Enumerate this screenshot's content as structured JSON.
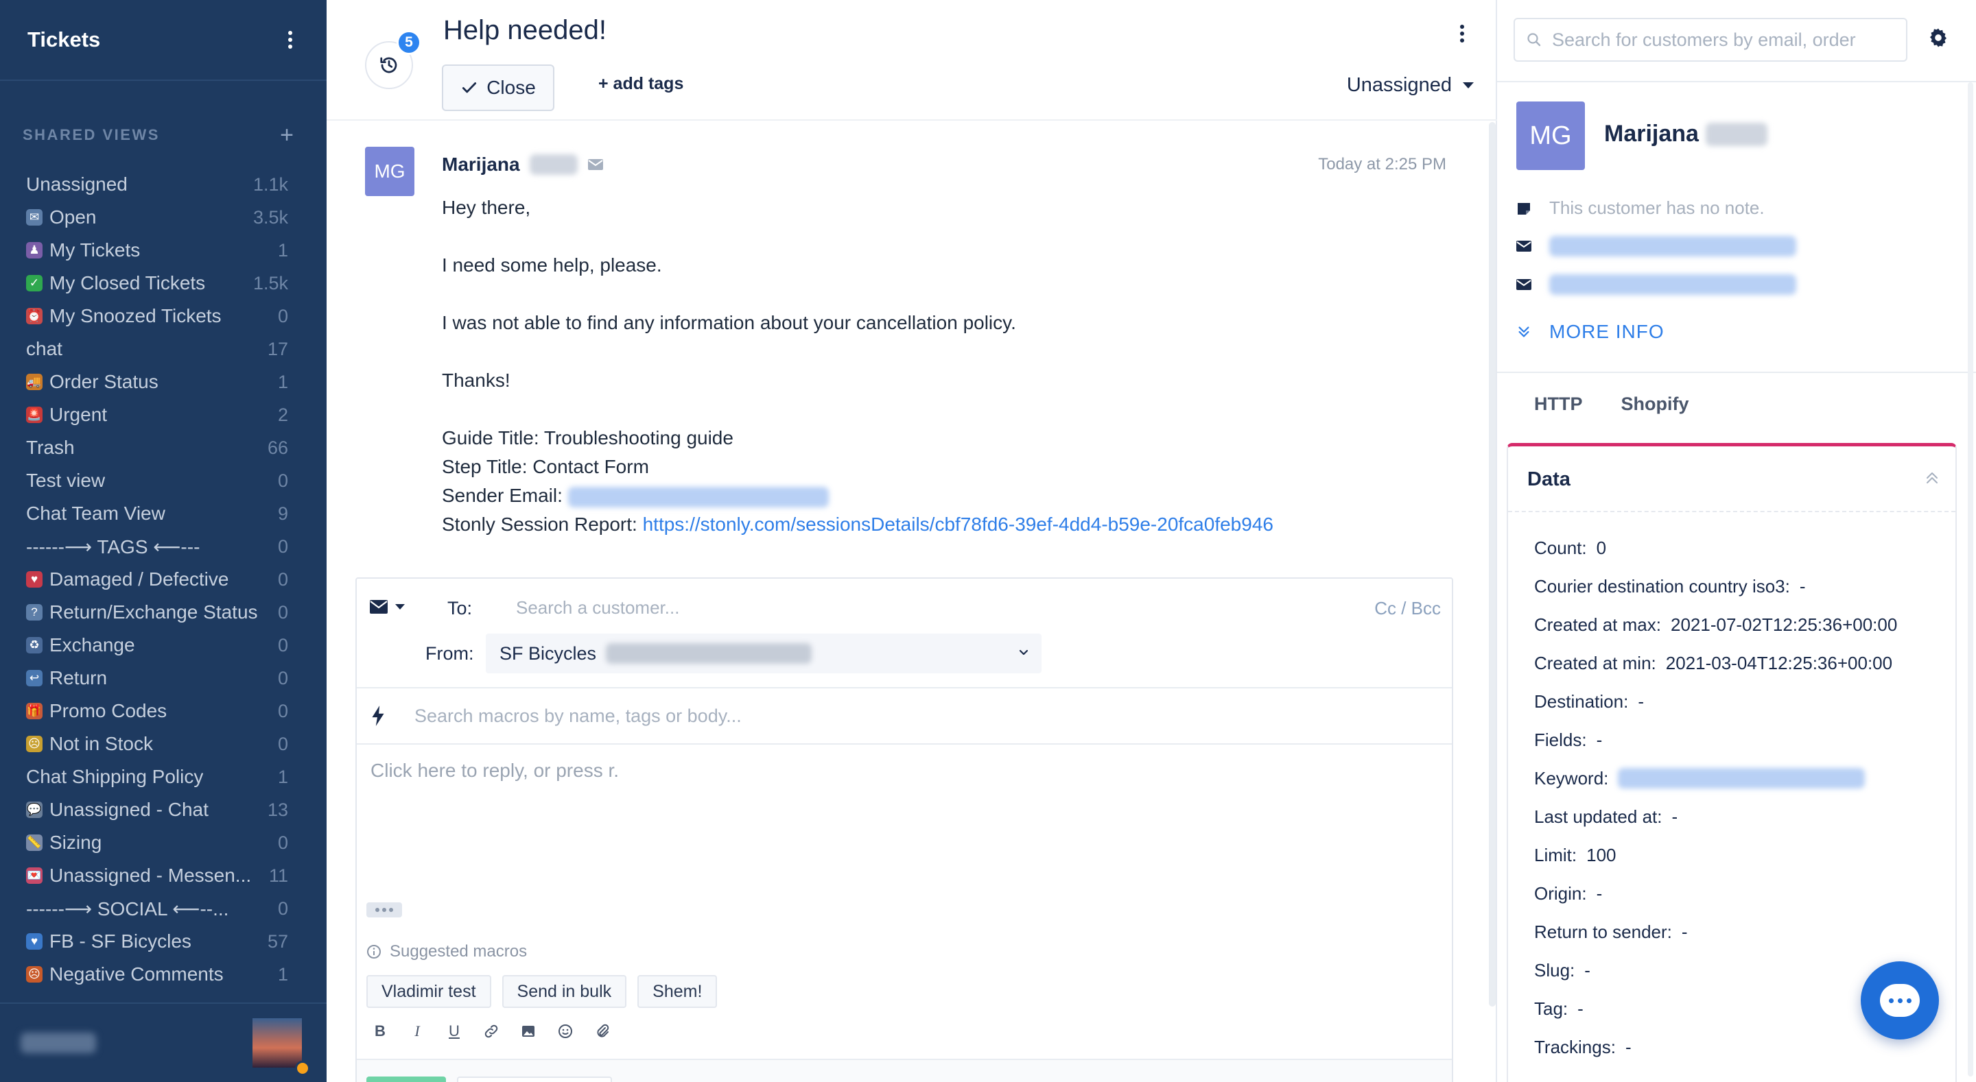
{
  "sidebar": {
    "title": "Tickets",
    "section_label": "SHARED VIEWS",
    "add_label": "+",
    "views": [
      {
        "label": "Unassigned",
        "count": "1.1k",
        "emoji": "",
        "color": ""
      },
      {
        "label": "Open",
        "count": "3.5k",
        "emoji": "✉",
        "color": "#5d7ea8"
      },
      {
        "label": "My Tickets",
        "count": "1",
        "emoji": "♟",
        "color": "#7b5ea8"
      },
      {
        "label": "My Closed Tickets",
        "count": "1.5k",
        "emoji": "✓",
        "color": "#2fa84f"
      },
      {
        "label": "My Snoozed Tickets",
        "count": "0",
        "emoji": "⏰",
        "color": "#c84a4a"
      },
      {
        "label": "chat",
        "count": "17",
        "emoji": "",
        "color": ""
      },
      {
        "label": "Order Status",
        "count": "1",
        "emoji": "🚚",
        "color": "#c87a2a"
      },
      {
        "label": "Urgent",
        "count": "2",
        "emoji": "🚨",
        "color": "#c83a3a"
      },
      {
        "label": "Trash",
        "count": "66",
        "emoji": "",
        "color": ""
      },
      {
        "label": "Test view",
        "count": "0",
        "emoji": "",
        "color": ""
      },
      {
        "label": "Chat Team View",
        "count": "9",
        "emoji": "",
        "color": ""
      },
      {
        "label": "------⟶ TAGS ⟵---",
        "count": "0",
        "emoji": "",
        "color": ""
      },
      {
        "label": "Damaged / Defective",
        "count": "0",
        "emoji": "♥",
        "color": "#c83a4a"
      },
      {
        "label": "Return/Exchange Status",
        "count": "0",
        "emoji": "?",
        "color": "#5d7ea8"
      },
      {
        "label": "Exchange",
        "count": "0",
        "emoji": "♻",
        "color": "#4a6a98"
      },
      {
        "label": "Return",
        "count": "0",
        "emoji": "↩",
        "color": "#4a78b0"
      },
      {
        "label": "Promo Codes",
        "count": "0",
        "emoji": "🎁",
        "color": "#c85a3a"
      },
      {
        "label": "Not in Stock",
        "count": "0",
        "emoji": "☹",
        "color": "#c8a030"
      },
      {
        "label": "Chat Shipping Policy",
        "count": "1",
        "emoji": "",
        "color": ""
      },
      {
        "label": "Unassigned - Chat",
        "count": "13",
        "emoji": "💬",
        "color": "#6a7e98"
      },
      {
        "label": "Sizing",
        "count": "0",
        "emoji": "📏",
        "color": "#7a8aa8"
      },
      {
        "label": "Unassigned - Messen...",
        "count": "11",
        "emoji": "💌",
        "color": "#c84a6a"
      },
      {
        "label": "------⟶ SOCIAL ⟵--...",
        "count": "0",
        "emoji": "",
        "color": ""
      },
      {
        "label": "FB - SF Bicycles",
        "count": "57",
        "emoji": "♥",
        "color": "#3a78c8"
      },
      {
        "label": "Negative Comments",
        "count": "1",
        "emoji": "☹",
        "color": "#c85a2a"
      }
    ]
  },
  "ticket": {
    "title": "Help needed!",
    "history_count": "5",
    "close_label": "Close",
    "add_tags_label": "add tags",
    "assignee": "Unassigned"
  },
  "message": {
    "avatar_initials": "MG",
    "sender_first_name": "Marijana",
    "time": "Today at 2:25 PM",
    "greeting": "Hey there,",
    "line1": "I need some help, please.",
    "line2": "I was not able to find any information about your cancellation policy.",
    "closing": "Thanks!",
    "guide_title_label": "Guide Title: Troubleshooting guide",
    "step_title_label": "Step Title: Contact Form",
    "sender_email_label": "Sender Email:",
    "session_report_label": "Stonly Session Report:",
    "session_report_url": "https://stonly.com/sessionsDetails/cbf78fd6-39ef-4dd4-b59e-20fca0feb946"
  },
  "editor": {
    "to_label": "To:",
    "to_placeholder": "Search a customer...",
    "cc_bcc": "Cc / Bcc",
    "from_label": "From:",
    "from_value": "SF Bicycles",
    "macro_placeholder": "Search macros by name, tags or body...",
    "reply_placeholder": "Click here to reply, or press r.",
    "suggested_label": "Suggested macros",
    "macros": [
      "Vladimir test",
      "Send in bulk",
      "Shem!"
    ]
  },
  "customer": {
    "search_placeholder": "Search for customers by email, order",
    "avatar_initials": "MG",
    "first_name": "Marijana",
    "no_note": "This customer has no note.",
    "more_info": "MORE INFO",
    "tabs": [
      "HTTP",
      "Shopify"
    ],
    "data_title": "Data",
    "fields": [
      {
        "key": "Count:",
        "value": "0"
      },
      {
        "key": "Courier destination country iso3:",
        "value": "-"
      },
      {
        "key": "Created at max:",
        "value": "2021-07-02T12:25:36+00:00"
      },
      {
        "key": "Created at min:",
        "value": "2021-03-04T12:25:36+00:00"
      },
      {
        "key": "Destination:",
        "value": "-"
      },
      {
        "key": "Fields:",
        "value": "-"
      },
      {
        "key": "Keyword:",
        "value": ""
      },
      {
        "key": "Last updated at:",
        "value": "-"
      },
      {
        "key": "Limit:",
        "value": "100"
      },
      {
        "key": "Origin:",
        "value": "-"
      },
      {
        "key": "Return to sender:",
        "value": "-"
      },
      {
        "key": "Slug:",
        "value": "-"
      },
      {
        "key": "Tag:",
        "value": "-"
      },
      {
        "key": "Trackings:",
        "value": "-"
      }
    ]
  },
  "colors": {
    "sidebar_bg": "#1e3a60",
    "accent_blue": "#2e7ee8",
    "avatar": "#7b87d8",
    "data_card_accent": "#d52b6a",
    "chat_fab": "#1f6ed8"
  }
}
